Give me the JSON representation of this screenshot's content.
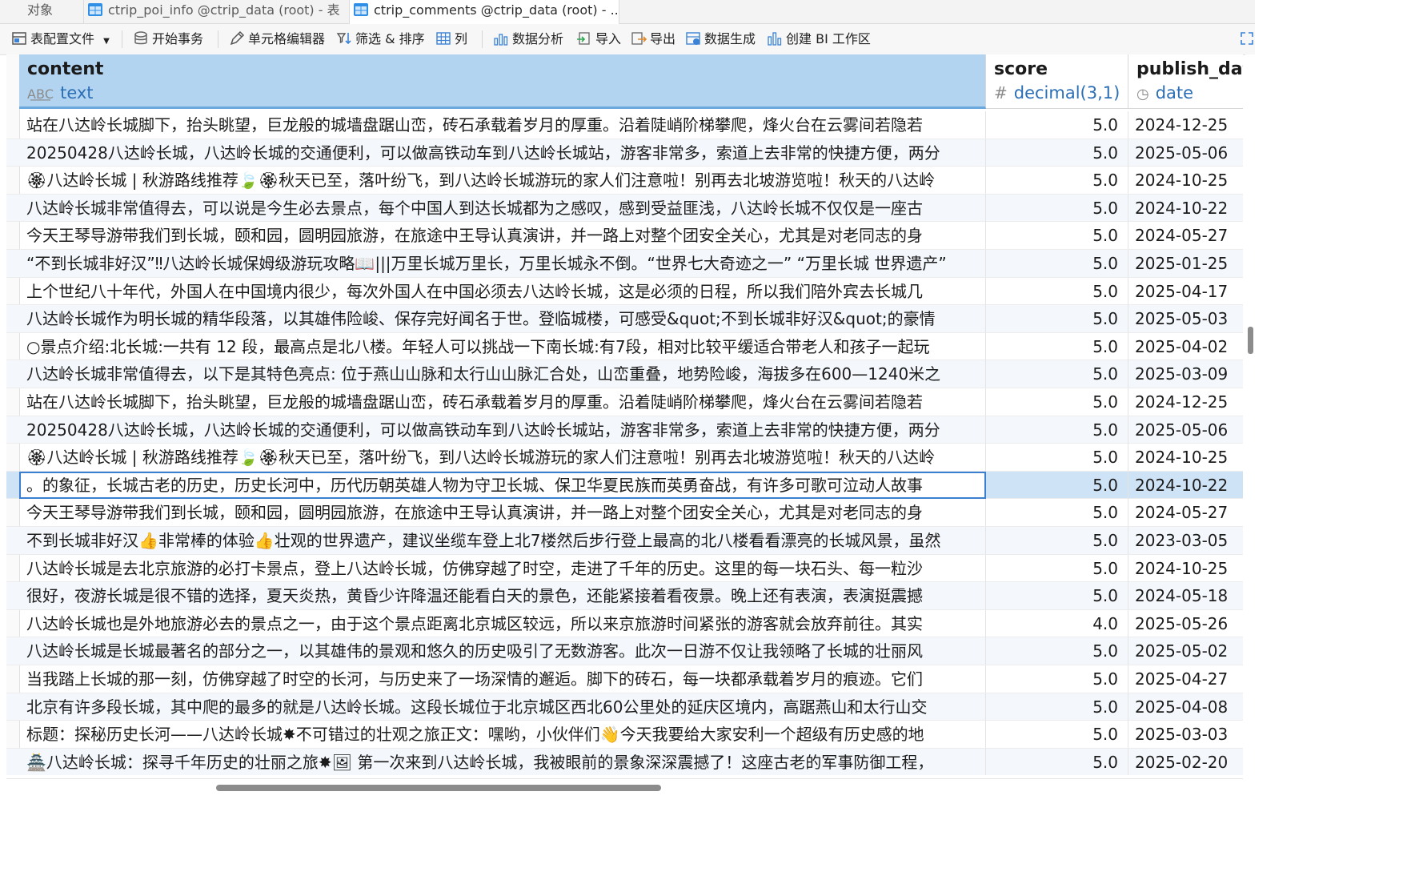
{
  "tabs": [
    {
      "label": "对象"
    },
    {
      "label": "ctrip_poi_info @ctrip_data (root) - 表"
    },
    {
      "label": "ctrip_comments @ctrip_data (root) - ..."
    }
  ],
  "toolbar": {
    "config_file": "表配置文件",
    "begin_transaction": "开始事务",
    "cell_editor": "单元格编辑器",
    "filter_sort": "筛选 & 排序",
    "columns": "列",
    "data_analysis": "数据分析",
    "import": "导入",
    "export": "导出",
    "data_generation": "数据生成",
    "create_bi": "创建 BI 工作区"
  },
  "columns": [
    {
      "name": "content",
      "type": "text",
      "type_icon": "text-type-icon"
    },
    {
      "name": "score",
      "type": "decimal(3,1)",
      "type_icon": "hash-icon"
    },
    {
      "name": "publish_date",
      "type": "date",
      "type_icon": "clock-icon"
    }
  ],
  "rows": [
    {
      "content": "站在八达岭长城脚下，抬头眺望，巨龙般的城墙盘踞山峦，砖石承载着岁月的厚重。沿着陡峭阶梯攀爬，烽火台在云雾间若隐若",
      "score": "5.0",
      "date": "2024-12-25"
    },
    {
      "content": "20250428八达岭长城，八达岭长城的交通便利，可以做高铁动车到八达岭长城站，游客非常多，索道上去非常的快捷方便，两分",
      "score": "5.0",
      "date": "2025-05-06"
    },
    {
      "content": "🏵八达岭长城 | 秋游路线推荐🍃🏵秋天已至，落叶纷飞，到八达岭长城游玩的家人们注意啦！别再去北坡游览啦！秋天的八达岭",
      "score": "5.0",
      "date": "2024-10-25"
    },
    {
      "content": "八达岭长城非常值得去，可以说是今生必去景点，每个中国人到达长城都为之感叹，感到受益匪浅，八达岭长城不仅仅是一座古",
      "score": "5.0",
      "date": "2024-10-22"
    },
    {
      "content": "今天王琴导游带我们到长城，颐和园，圆明园旅游，在旅途中王导认真演讲，并一路上对整个团安全关心，尤其是对老同志的身",
      "score": "5.0",
      "date": "2024-05-27"
    },
    {
      "content": "“不到长城非好汉”‼八达岭长城保姆级游玩攻略📖|||万里长城万里长，万里长城永不倒。“世界七大奇迹之一” “万里长城 世界遗产”",
      "score": "5.0",
      "date": "2025-01-25"
    },
    {
      "content": "上个世纪八十年代，外国人在中国境内很少，每次外国人在中国必须去八达岭长城，这是必须的日程，所以我们陪外宾去长城几",
      "score": "5.0",
      "date": "2025-04-17"
    },
    {
      "content": "八达岭长城作为明长城的精华段落，以其雄伟险峻、保存完好闻名于世。登临城楼，可感受&quot;不到长城非好汉&quot;的豪情",
      "score": "5.0",
      "date": "2025-05-03"
    },
    {
      "content": "○景点介绍:北长城:一共有 12 段，最高点是北八楼。年轻人可以挑战一下南长城:有7段，相对比较平缓适合带老人和孩子一起玩",
      "score": "5.0",
      "date": "2025-04-02"
    },
    {
      "content": "八达岭长城非常值得去，以下是其特色亮点: 位于燕山山脉和太行山山脉汇合处，山峦重叠，地势险峻，海拔多在600—1240米之",
      "score": "5.0",
      "date": "2025-03-09"
    },
    {
      "content": "站在八达岭长城脚下，抬头眺望，巨龙般的城墙盘踞山峦，砖石承载着岁月的厚重。沿着陡峭阶梯攀爬，烽火台在云雾间若隐若",
      "score": "5.0",
      "date": "2024-12-25"
    },
    {
      "content": "20250428八达岭长城，八达岭长城的交通便利，可以做高铁动车到八达岭长城站，游客非常多，索道上去非常的快捷方便，两分",
      "score": "5.0",
      "date": "2025-05-06"
    },
    {
      "content": "🏵八达岭长城 | 秋游路线推荐🍃🏵秋天已至，落叶纷飞，到八达岭长城游玩的家人们注意啦！别再去北坡游览啦！秋天的八达岭",
      "score": "5.0",
      "date": "2024-10-25"
    },
    {
      "content": "的象征，长城古老的历史，历史长河中，历代历朝英雄人物为守卫长城、保卫华夏民族而英勇奋战，有许多可歌可泣动人故事。",
      "score": "5.0",
      "date": "2024-10-22",
      "active": true
    },
    {
      "content": "今天王琴导游带我们到长城，颐和园，圆明园旅游，在旅途中王导认真演讲，并一路上对整个团安全关心，尤其是对老同志的身",
      "score": "5.0",
      "date": "2024-05-27"
    },
    {
      "content": "不到长城非好汉👍非常棒的体验👍壮观的世界遗产，建议坐缆车登上北7楼然后步行登上最高的北八楼看看漂亮的长城风景，虽然",
      "score": "5.0",
      "date": "2023-03-05"
    },
    {
      "content": "八达岭长城是去北京旅游的必打卡景点，登上八达岭长城，仿佛穿越了时空，走进了千年的历史。这里的每一块石头、每一粒沙",
      "score": "5.0",
      "date": "2024-10-25"
    },
    {
      "content": "很好，夜游长城是很不错的选择，夏天炎热，黄昏少许降温还能看白天的景色，还能紧接着看夜景。晚上还有表演，表演挺震撼",
      "score": "5.0",
      "date": "2024-05-18"
    },
    {
      "content": "八达岭长城也是外地旅游必去的景点之一，由于这个景点距离北京城区较远，所以来京旅游时间紧张的游客就会放弃前往。其实",
      "score": "4.0",
      "date": "2025-05-26"
    },
    {
      "content": "八达岭长城是长城最著名的部分之一，以其雄伟的景观和悠久的历史吸引了无数游客。此次一日游不仅让我领略了长城的壮丽风",
      "score": "5.0",
      "date": "2025-05-02"
    },
    {
      "content": "当我踏上长城的那一刻，仿佛穿越了时空的长河，与历史来了一场深情的邂逅。脚下的砖石，每一块都承载着岁月的痕迹。它们",
      "score": "5.0",
      "date": "2025-04-27"
    },
    {
      "content": "北京有许多段长城，其中爬的最多的就是八达岭长城。这段长城位于北京城区西北60公里处的延庆区境内，高踞燕山和太行山交",
      "score": "5.0",
      "date": "2025-04-08"
    },
    {
      "content": "标题：探秘历史长河——八达岭长城✸不可错过的壮观之旅正文：嘿哟，小伙伴们👋今天我要给大家安利一个超级有历史感的地",
      "score": "5.0",
      "date": "2025-03-03"
    },
    {
      "content": "🏯八达岭长城：探寻千年历史的壮丽之旅✸🖼 第一次来到八达岭长城，我被眼前的景象深深震撼了！这座古老的军事防御工程，",
      "score": "5.0",
      "date": "2025-02-20"
    }
  ]
}
